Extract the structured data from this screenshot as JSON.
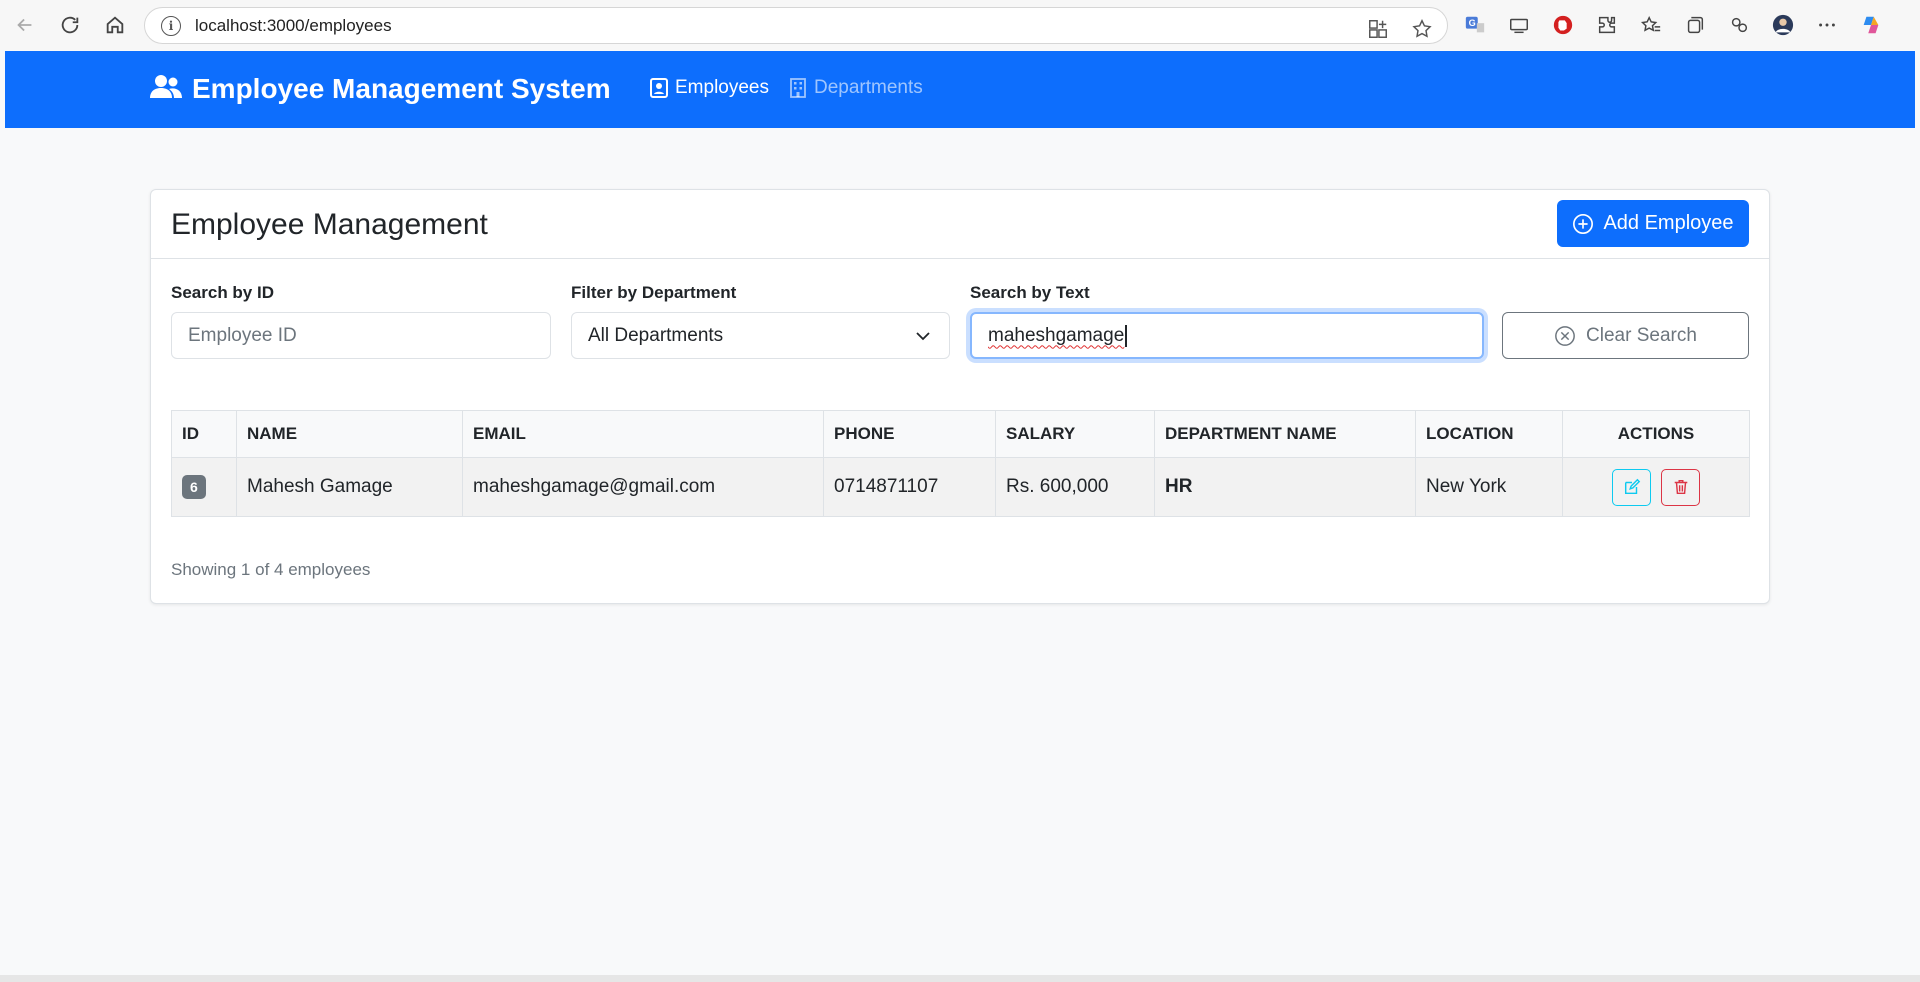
{
  "browser": {
    "url": "localhost:3000/employees"
  },
  "navbar": {
    "brand": "Employee Management System",
    "links": [
      {
        "label": "Employees",
        "active": true
      },
      {
        "label": "Departments",
        "active": false
      }
    ],
    "color": "#0d6efd"
  },
  "card": {
    "title": "Employee Management",
    "add_button_label": "Add Employee"
  },
  "filters": {
    "search_id_label": "Search by ID",
    "search_id_placeholder": "Employee ID",
    "department_label": "Filter by Department",
    "department_selected": "All Departments",
    "search_text_label": "Search by Text",
    "search_text_value": "maheshgamage",
    "clear_button_label": "Clear Search"
  },
  "table": {
    "headers": [
      "ID",
      "NAME",
      "EMAIL",
      "PHONE",
      "SALARY",
      "DEPARTMENT NAME",
      "LOCATION",
      "ACTIONS"
    ],
    "rows": [
      {
        "id": "6",
        "name": "Mahesh Gamage",
        "email": "maheshgamage@gmail.com",
        "phone": "0714871107",
        "salary": "Rs. 600,000",
        "department": "HR",
        "location": "New York"
      }
    ]
  },
  "footer": {
    "summary": "Showing 1 of 4 employees"
  }
}
